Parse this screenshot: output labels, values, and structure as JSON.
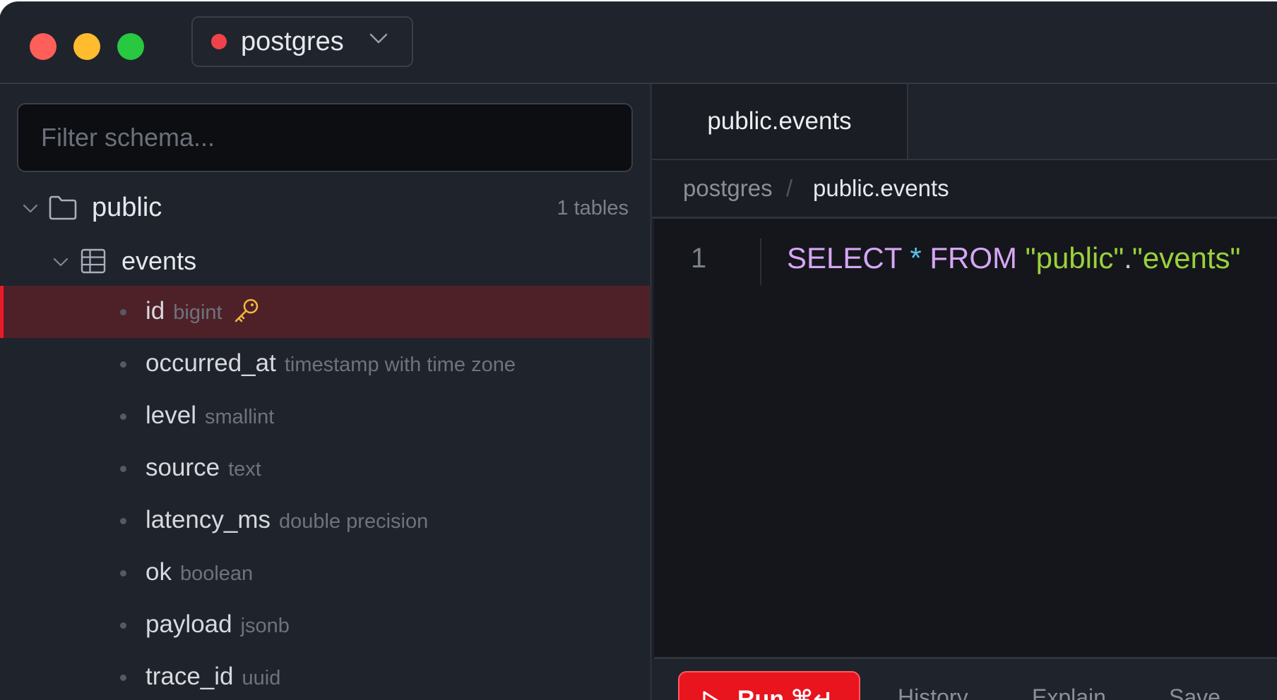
{
  "titlebar": {
    "connection": {
      "name": "postgres",
      "status_color": "#f0424a"
    }
  },
  "sidebar": {
    "filter_placeholder": "Filter schema...",
    "schema": {
      "name": "public",
      "table_count": "1 tables"
    },
    "table": {
      "name": "events"
    },
    "columns": [
      {
        "name": "id",
        "type": "bigint",
        "primary_key": true,
        "selected": true
      },
      {
        "name": "occurred_at",
        "type": "timestamp with time zone"
      },
      {
        "name": "level",
        "type": "smallint"
      },
      {
        "name": "source",
        "type": "text"
      },
      {
        "name": "latency_ms",
        "type": "double precision"
      },
      {
        "name": "ok",
        "type": "boolean"
      },
      {
        "name": "payload",
        "type": "jsonb"
      },
      {
        "name": "trace_id",
        "type": "uuid"
      }
    ]
  },
  "main": {
    "tab_label": "public.events",
    "breadcrumb": {
      "root": "postgres",
      "separator": "/",
      "leaf": "public.events"
    },
    "editor": {
      "line_number": "1",
      "tokens": [
        {
          "text": "SELECT",
          "kind": "kw"
        },
        {
          "text": " ",
          "kind": "pl"
        },
        {
          "text": "*",
          "kind": "op"
        },
        {
          "text": " ",
          "kind": "pl"
        },
        {
          "text": "FROM",
          "kind": "kw"
        },
        {
          "text": " ",
          "kind": "pl"
        },
        {
          "text": "\"public\"",
          "kind": "str"
        },
        {
          "text": ".",
          "kind": "pl"
        },
        {
          "text": "\"events\"",
          "kind": "str"
        }
      ]
    },
    "actions": {
      "run_label": "Run ⌘↵",
      "history": "History",
      "explain": "Explain",
      "save": "Save"
    }
  },
  "colors": {
    "accent": "#e8141e",
    "selected_row": "#4e2129",
    "keyword": "#d7a6f5",
    "string": "#9ad13b",
    "operator": "#58c4ea"
  }
}
